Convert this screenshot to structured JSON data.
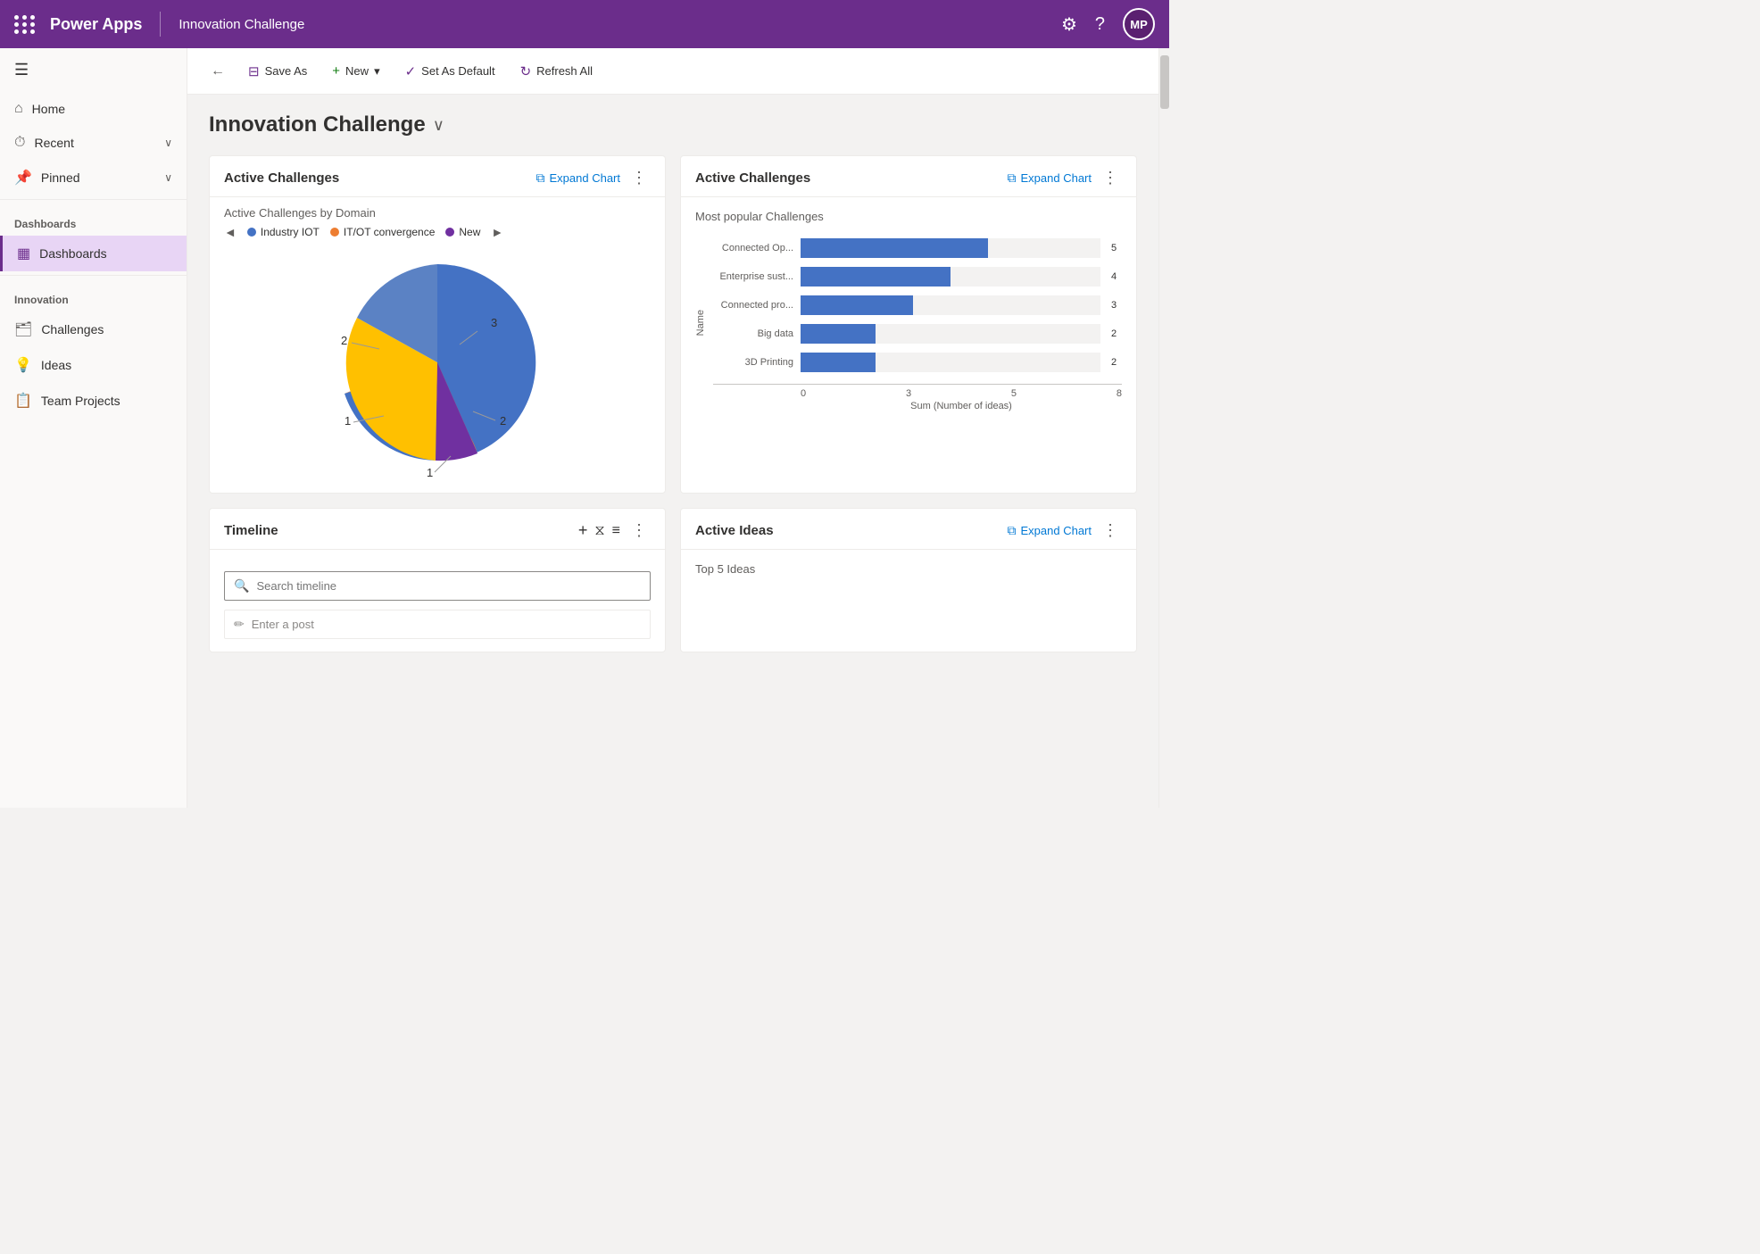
{
  "topnav": {
    "app_name": "Power Apps",
    "page_title": "Innovation Challenge",
    "avatar_initials": "MP"
  },
  "toolbar": {
    "back_label": "←",
    "save_as_label": "Save As",
    "new_label": "New",
    "set_as_default_label": "Set As Default",
    "refresh_all_label": "Refresh All",
    "new_dropdown_icon": "▾"
  },
  "sidebar": {
    "hamburger": "☰",
    "items": [
      {
        "id": "home",
        "label": "Home",
        "icon": "⌂"
      },
      {
        "id": "recent",
        "label": "Recent",
        "icon": "⏱",
        "arrow": "∨"
      },
      {
        "id": "pinned",
        "label": "Pinned",
        "icon": "📌",
        "arrow": "∨"
      }
    ],
    "dashboards_header": "Dashboards",
    "dashboards_items": [
      {
        "id": "dashboards",
        "label": "Dashboards",
        "icon": "▦",
        "active": true
      }
    ],
    "innovation_header": "Innovation",
    "innovation_items": [
      {
        "id": "challenges",
        "label": "Challenges",
        "icon": "🗂"
      },
      {
        "id": "ideas",
        "label": "Ideas",
        "icon": "💡"
      },
      {
        "id": "team-projects",
        "label": "Team Projects",
        "icon": "📋"
      }
    ]
  },
  "page": {
    "title": "Innovation Challenge",
    "title_chevron": "∨"
  },
  "cards": {
    "active_challenges_pie": {
      "title": "Active Challenges",
      "expand_label": "Expand Chart",
      "subtitle": "Active Challenges by Domain",
      "legend": [
        {
          "label": "Industry IOT",
          "color": "#4472c4"
        },
        {
          "label": "IT/OT convergence",
          "color": "#ed7d31"
        },
        {
          "label": "New",
          "color": "#7030a0"
        }
      ],
      "pie_data": [
        {
          "label": "3",
          "value": 3,
          "color": "#4472c4",
          "start": 0,
          "end": 180
        },
        {
          "label": "2",
          "value": 2,
          "color": "#ed7d31",
          "start": 180,
          "end": 288
        },
        {
          "label": "1",
          "value": 1,
          "color": "#7030a0",
          "start": 288,
          "end": 324
        },
        {
          "label": "1",
          "value": 1,
          "color": "#ffc000",
          "start": 324,
          "end": 360
        },
        {
          "label": "2",
          "value": 2,
          "color": "#4472c4",
          "start": 0,
          "end": 0
        }
      ],
      "segments_labels": [
        "3",
        "2",
        "1",
        "1",
        "2"
      ]
    },
    "active_challenges_bar": {
      "title": "Active Challenges",
      "expand_label": "Expand Chart",
      "subtitle": "Most popular Challenges",
      "y_axis_label": "Name",
      "x_axis_label": "Sum (Number of ideas)",
      "x_ticks": [
        "0",
        "3",
        "5",
        "8"
      ],
      "max_value": 8,
      "bars": [
        {
          "label": "Connected Op...",
          "value": 5
        },
        {
          "label": "Enterprise sust...",
          "value": 4
        },
        {
          "label": "Connected pro...",
          "value": 3
        },
        {
          "label": "Big data",
          "value": 2
        },
        {
          "label": "3D Printing",
          "value": 2
        }
      ]
    },
    "timeline": {
      "title": "Timeline",
      "add_icon": "+",
      "filter_icon": "⧖",
      "sort_icon": "≡",
      "menu_icon": "⋮",
      "search_placeholder": "Search timeline",
      "post_placeholder": "Enter a post"
    },
    "active_ideas": {
      "title": "Active Ideas",
      "expand_label": "Expand Chart",
      "subtitle": "Top 5 Ideas"
    }
  }
}
